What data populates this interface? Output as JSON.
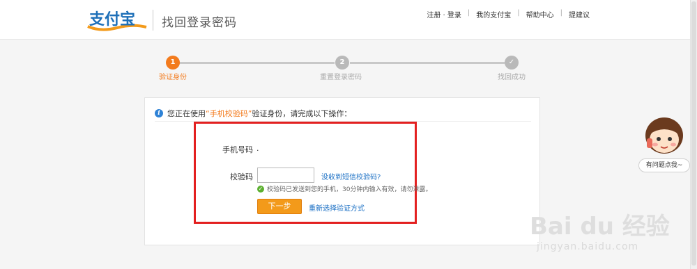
{
  "header": {
    "logo_text": "支付宝",
    "page_title": "找回登录密码",
    "links": [
      "注册 · 登录",
      "我的支付宝",
      "帮助中心",
      "提建议"
    ],
    "separator": "|"
  },
  "steps": [
    {
      "number": "1",
      "label": "验证身份",
      "state": "active"
    },
    {
      "number": "2",
      "label": "重置登录密码",
      "state": "pending"
    },
    {
      "number": "✓",
      "label": "找回成功",
      "state": "pending"
    }
  ],
  "notice": {
    "prefix": "您正在使用",
    "method": "“手机校验码”",
    "suffix": "验证身份，请完成以下操作："
  },
  "form": {
    "phone_label": "手机号码",
    "phone_value": ".",
    "code_label": "校验码",
    "code_value": "",
    "resend_link": "没收到短信校验码?",
    "tip": "校验码已发送到您的手机，30分钟内输入有效，请勿泄露。",
    "next_button": "下一步",
    "change_method_link": "重新选择验证方式"
  },
  "helper": {
    "bubble_text": "有问题点我~"
  },
  "watermark": {
    "main": "Bai du 经验",
    "sub": "jingyan.baidu.com"
  },
  "colors": {
    "accent": "#f37b1d",
    "link": "#1a6fc4",
    "highlight_box": "#e32020"
  }
}
